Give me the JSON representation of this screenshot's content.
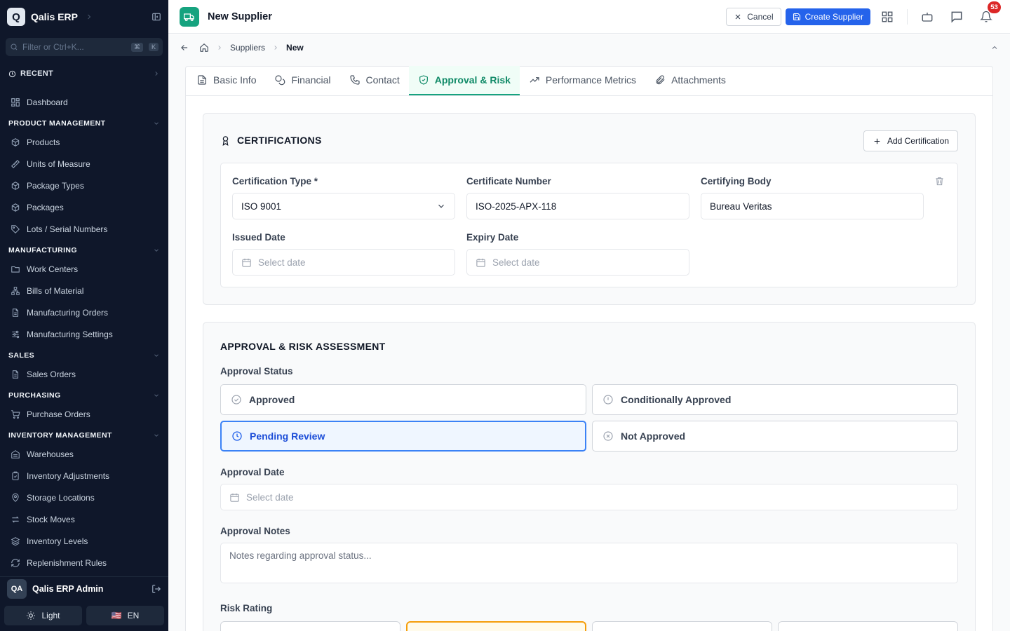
{
  "app": {
    "name": "Qalis ERP",
    "logo_letter": "Q"
  },
  "sidebar": {
    "filter_placeholder": "Filter or Ctrl+K...",
    "kbd": [
      "⌘",
      "K"
    ],
    "recent_label": "RECENT",
    "dashboard": "Dashboard",
    "sections": [
      {
        "title": "PRODUCT MANAGEMENT",
        "items": [
          "Products",
          "Units of Measure",
          "Package Types",
          "Packages",
          "Lots / Serial Numbers"
        ]
      },
      {
        "title": "MANUFACTURING",
        "items": [
          "Work Centers",
          "Bills of Material",
          "Manufacturing Orders",
          "Manufacturing Settings"
        ]
      },
      {
        "title": "SALES",
        "items": [
          "Sales Orders"
        ]
      },
      {
        "title": "PURCHASING",
        "items": [
          "Purchase Orders"
        ]
      },
      {
        "title": "INVENTORY MANAGEMENT",
        "items": [
          "Warehouses",
          "Inventory Adjustments",
          "Storage Locations",
          "Stock Moves",
          "Inventory Levels",
          "Replenishment Rules"
        ]
      }
    ],
    "user": {
      "initials": "QA",
      "name": "Qalis ERP Admin"
    },
    "theme_label": "Light",
    "lang_label": "EN",
    "lang_flag": "🇺🇸"
  },
  "topbar": {
    "title": "New Supplier",
    "cancel_label": "Cancel",
    "create_label": "Create Supplier",
    "notification_count": "53"
  },
  "breadcrumb": {
    "items": [
      "Suppliers",
      "New"
    ]
  },
  "tabs": [
    {
      "label": "Basic Info",
      "icon": "document-icon"
    },
    {
      "label": "Financial",
      "icon": "coins-icon"
    },
    {
      "label": "Contact",
      "icon": "phone-icon"
    },
    {
      "label": "Approval & Risk",
      "icon": "shield-check-icon",
      "active": true
    },
    {
      "label": "Performance Metrics",
      "icon": "trending-up-icon"
    },
    {
      "label": "Attachments",
      "icon": "paperclip-icon"
    }
  ],
  "certifications": {
    "title": "CERTIFICATIONS",
    "add_label": "Add Certification",
    "type_label": "Certification Type *",
    "type_value": "ISO 9001",
    "number_label": "Certificate Number",
    "number_value": "ISO-2025-APX-118",
    "body_label": "Certifying Body",
    "body_value": "Bureau Veritas",
    "issued_label": "Issued Date",
    "issued_placeholder": "Select date",
    "expiry_label": "Expiry Date",
    "expiry_placeholder": "Select date"
  },
  "approval": {
    "title": "APPROVAL & RISK ASSESSMENT",
    "status_label": "Approval Status",
    "statuses": [
      {
        "label": "Approved",
        "icon": "check-circle-icon"
      },
      {
        "label": "Conditionally Approved",
        "icon": "alert-circle-icon"
      },
      {
        "label": "Pending Review",
        "icon": "clock-icon",
        "selected": true
      },
      {
        "label": "Not Approved",
        "icon": "x-circle-icon"
      }
    ],
    "date_label": "Approval Date",
    "date_placeholder": "Select date",
    "notes_label": "Approval Notes",
    "notes_placeholder": "Notes regarding approval status...",
    "risk_label": "Risk Rating"
  },
  "colors": {
    "accent": "#16a37f",
    "primary": "#2563eb",
    "sidebar": "#0f172a",
    "selected": "#3b82f6",
    "risk_selected": "#f59e0b"
  }
}
